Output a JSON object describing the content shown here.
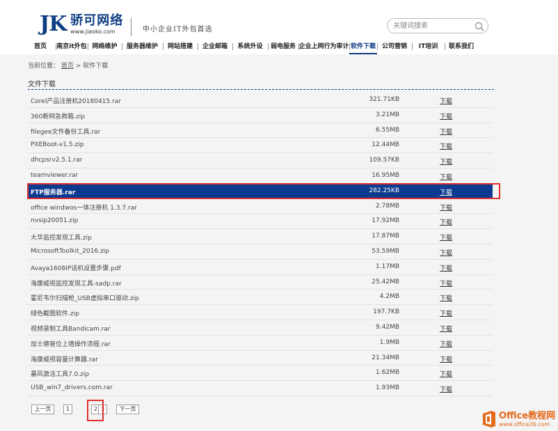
{
  "header": {
    "logo_mark": "JK",
    "logo_name": "骄可网络",
    "logo_url": "www.jiaoko.com",
    "slogan": "中小企业IT外包首选",
    "search_placeholder": "关键词搜索"
  },
  "nav": {
    "items": [
      {
        "label": "首页"
      },
      {
        "label": "南京it外包"
      },
      {
        "label": "网络维护"
      },
      {
        "label": "服务器维护"
      },
      {
        "label": "网站搭建"
      },
      {
        "label": "企业邮箱"
      },
      {
        "label": "系统外设"
      },
      {
        "label": "弱电服务"
      },
      {
        "label": "企业上网行为审计"
      },
      {
        "label": "软件下载"
      },
      {
        "label": "公司营销"
      },
      {
        "label": "IT培训"
      },
      {
        "label": "联系我们"
      }
    ],
    "active": "软件下载"
  },
  "breadcrumb": {
    "prefix": "当前位置：",
    "home": "首页",
    "sep": ">",
    "current": "软件下载"
  },
  "section_title": "文件下载",
  "files": [
    {
      "name": "Corel产品注册机20180415.rar",
      "size": "321.71KB",
      "action": "下载"
    },
    {
      "name": "360断网急救箱.zip",
      "size": "3.21MB",
      "action": "下载"
    },
    {
      "name": "filegee文件备份工具.rar",
      "size": "6.55MB",
      "action": "下载"
    },
    {
      "name": "PXEBoot-v1.5.zip",
      "size": "12.44MB",
      "action": "下载"
    },
    {
      "name": "dhcpsrv2.5.1.rar",
      "size": "109.57KB",
      "action": "下载"
    },
    {
      "name": "teamviewer.rar",
      "size": "16.95MB",
      "action": "下载"
    },
    {
      "name": "FTP服务器.rar",
      "size": "282.25KB",
      "action": "下载",
      "selected": true
    },
    {
      "name": "office windwos一体注册机 1.3.7.rar",
      "size": "2.78MB",
      "action": "下载"
    },
    {
      "name": "nvsip20051.zip",
      "size": "17.92MB",
      "action": "下载"
    },
    {
      "name": "大华监控发现工具.zip",
      "size": "17.87MB",
      "action": "下载"
    },
    {
      "name": "MicrosoftToolkit_2016.zip",
      "size": "53.59MB",
      "action": "下载"
    },
    {
      "name": "Avaya1608IP话机设置步骤.pdf",
      "size": "1.17MB",
      "action": "下载"
    },
    {
      "name": "海康威视监控发现工具-sadp.rar",
      "size": "25.42MB",
      "action": "下载"
    },
    {
      "name": "霍尼韦尔扫描枪_USB虚拟串口驱动.zip",
      "size": "4.2MB",
      "action": "下载"
    },
    {
      "name": "绿色截图软件.zip",
      "size": "197.7KB",
      "action": "下载"
    },
    {
      "name": "视频录制工具Bandicam.rar",
      "size": "9.42MB",
      "action": "下载"
    },
    {
      "name": "加士德管位上墙操作流程.rar",
      "size": "1.9MB",
      "action": "下载"
    },
    {
      "name": "海康威视容量计算器.rar",
      "size": "21.34MB",
      "action": "下载"
    },
    {
      "name": "暴风激活工具7.0.zip",
      "size": "1.62MB",
      "action": "下载"
    },
    {
      "name": "USB_win7_drivers.com.rar",
      "size": "1.93MB",
      "action": "下载"
    }
  ],
  "pagination": {
    "prev": "上一页",
    "pages": [
      "1",
      "2",
      "3"
    ],
    "current": "2",
    "next": "下一页"
  },
  "watermark": {
    "title": "Office教程网",
    "url": "www.office26.com"
  },
  "colors": {
    "brand": "#0e3c82",
    "selected_row": "#0c3a8e",
    "highlight": "#e03030",
    "watermark": "#e46a1b"
  }
}
